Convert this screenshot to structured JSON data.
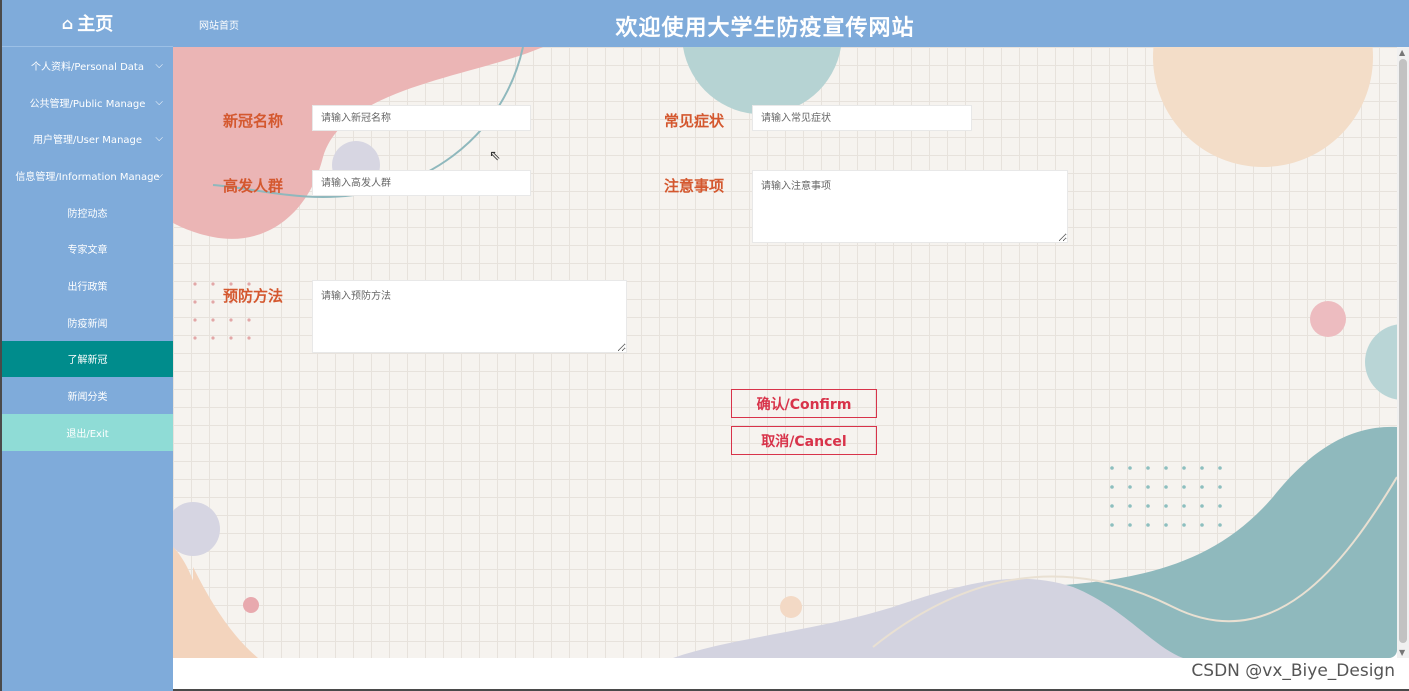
{
  "sidebar": {
    "logo": "主页",
    "items": [
      {
        "label": "个人资料/Personal Data",
        "chevron": true
      },
      {
        "label": "公共管理/Public Manage",
        "chevron": true
      },
      {
        "label": "用户管理/User Manage",
        "chevron": true
      },
      {
        "label": "信息管理/Information Manage",
        "chevron": true
      },
      {
        "label": "防控动态"
      },
      {
        "label": "专家文章"
      },
      {
        "label": "出行政策"
      },
      {
        "label": "防疫新闻"
      },
      {
        "label": "了解新冠",
        "active": true
      },
      {
        "label": "新闻分类"
      },
      {
        "label": "退出/Exit"
      }
    ]
  },
  "header": {
    "breadcrumb": "网站首页",
    "title": "欢迎使用大学生防疫宣传网站"
  },
  "form": {
    "name_label": "新冠名称",
    "name_placeholder": "请输入新冠名称",
    "symptom_label": "常见症状",
    "symptom_placeholder": "请输入常见症状",
    "group_label": "高发人群",
    "group_placeholder": "请输入高发人群",
    "notes_label": "注意事项",
    "notes_placeholder": "请输入注意事项",
    "prevent_label": "预防方法",
    "prevent_placeholder": "请输入预防方法",
    "confirm": "确认/Confirm",
    "cancel": "取消/Cancel"
  },
  "watermark": "CSDN @vx_Biye_Design",
  "colors": {
    "sidebar": "#7fabda",
    "active_item": "#008c8c",
    "exit_item": "#8fdcd6",
    "label": "#d4582f",
    "button": "#d8334a"
  }
}
